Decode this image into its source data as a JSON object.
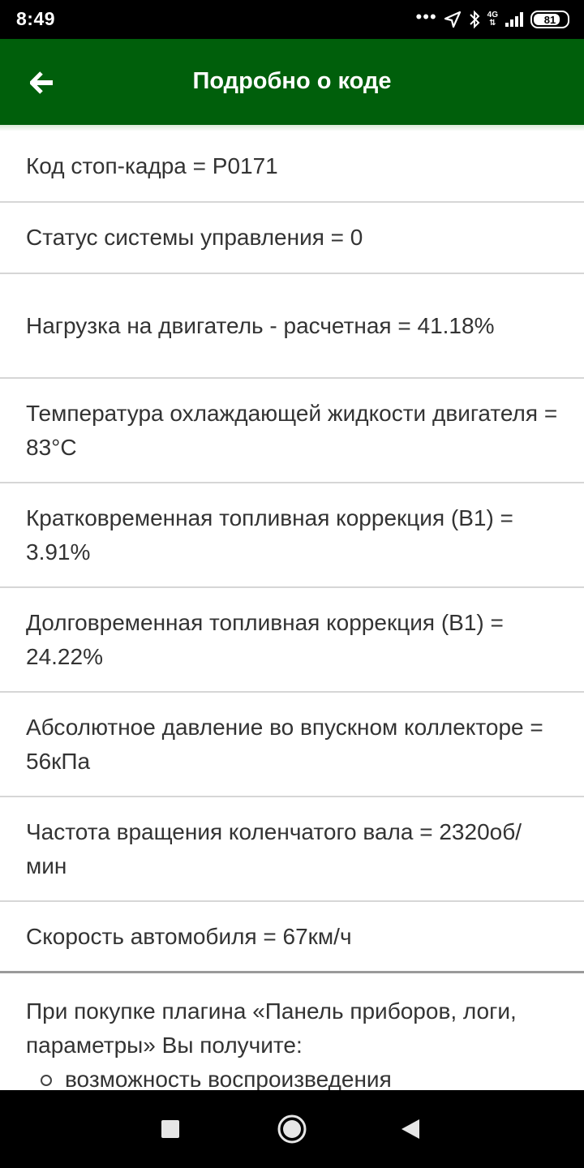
{
  "status_bar": {
    "time": "8:49",
    "network": "4G",
    "battery": "81",
    "battery_level_percent": 81
  },
  "app_bar": {
    "title": "Подробно о коде",
    "back_icon": "arrow-left-icon",
    "background_color": "#005f0b"
  },
  "rows": [
    {
      "text": "Код стоп-кадра = P0171"
    },
    {
      "text": "Статус системы управления = 0"
    },
    {
      "text": "Нагрузка на двигатель - расчетная = 41.18%"
    },
    {
      "text": "Температура охлаждающей жидкости двигателя = 83°C"
    },
    {
      "text": "Кратковременная топливная коррекция (B1) = 3.91%"
    },
    {
      "text": "Долговременная топливная коррекция (B1) = 24.22%"
    },
    {
      "text": "Абсолютное давление во впускном коллекторе = 56кПа"
    },
    {
      "text": "Частота вращения коленчатого вала = 2320об/мин"
    },
    {
      "text": "Скорость автомобиля = 67км/ч"
    }
  ],
  "promo": {
    "intro": "При покупке плагина «Панель приборов, логи, параметры» Вы получите:",
    "items": [
      "возможность воспроизведения"
    ]
  },
  "nav_bar": {
    "recents_icon": "square-icon",
    "home_icon": "circle-icon",
    "back_icon": "triangle-back-icon"
  }
}
